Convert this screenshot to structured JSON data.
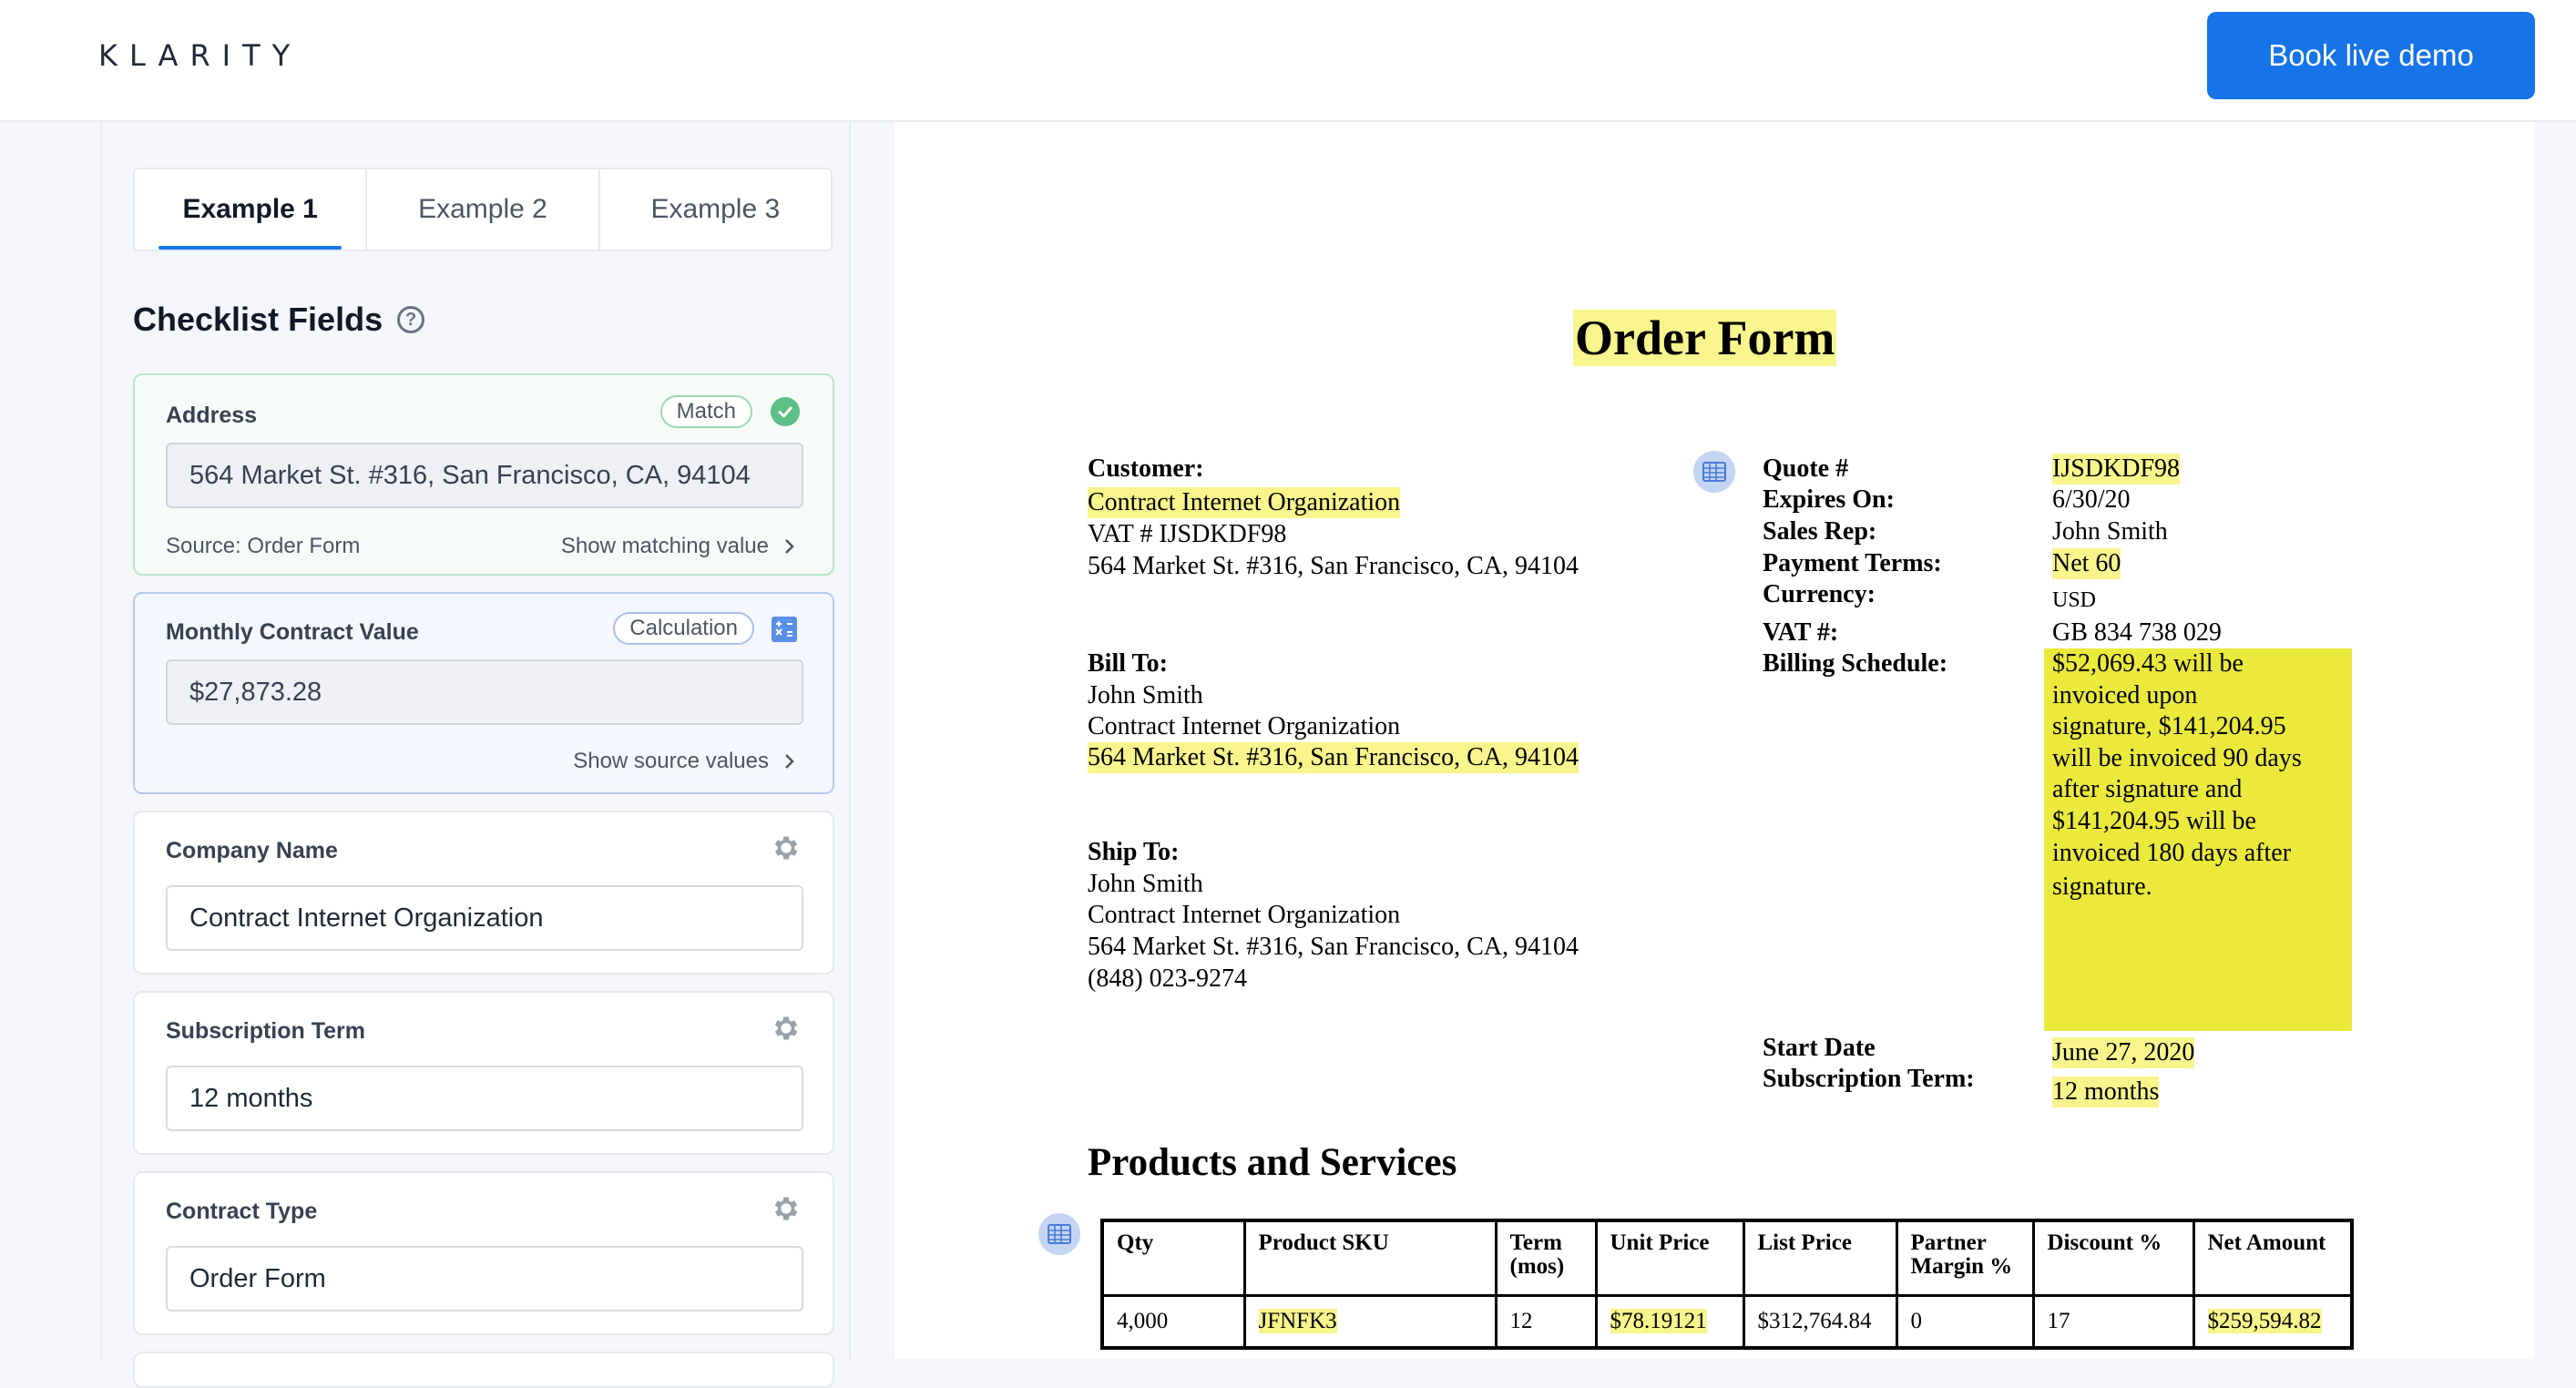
{
  "header": {
    "logo": "KLARITY",
    "demo_button": "Book live demo"
  },
  "tabs": [
    {
      "label": "Example 1",
      "active": true
    },
    {
      "label": "Example 2",
      "active": false
    },
    {
      "label": "Example 3",
      "active": false
    }
  ],
  "checklist": {
    "title": "Checklist Fields",
    "address": {
      "label": "Address",
      "badge": "Match",
      "value": "564 Market St. #316, San Francisco, CA, 94104",
      "source": "Source: Order Form",
      "link": "Show matching value"
    },
    "monthly": {
      "label": "Monthly Contract Value",
      "badge": "Calculation",
      "value": "$27,873.28",
      "link": "Show source values"
    },
    "company": {
      "label": "Company Name",
      "value": "Contract Internet Organization"
    },
    "subscription": {
      "label": "Subscription Term",
      "value": "12 months"
    },
    "contract_type": {
      "label": "Contract Type",
      "value": "Order Form"
    }
  },
  "document": {
    "title": "Order Form",
    "customer": {
      "label": "Customer:",
      "name": "Contract Internet Organization",
      "vat": "VAT # IJSDKDF98",
      "address": "564 Market St. #316, San Francisco, CA, 94104"
    },
    "bill_to": {
      "label": "Bill To:",
      "person": "John Smith",
      "org": "Contract Internet Organization",
      "address": "564 Market St. #316, San Francisco, CA, 94104"
    },
    "ship_to": {
      "label": "Ship To:",
      "person": "John Smith",
      "org": "Contract Internet Organization",
      "address": "564 Market St. #316, San Francisco, CA, 94104",
      "phone": "(848) 023-9274"
    },
    "quote": {
      "quote_label": "Quote #",
      "quote_value": "IJSDKDF98",
      "expires_label": "Expires On:",
      "expires_value": "6/30/20",
      "rep_label": "Sales Rep:",
      "rep_value": "John Smith",
      "terms_label": "Payment Terms:",
      "terms_value": "Net 60",
      "currency_label": "Currency:",
      "currency_value": "USD",
      "vat_label": "VAT #:",
      "vat_value": "GB 834 738 029",
      "billing_label": "Billing Schedule:",
      "billing_lines": [
        "$52,069.43 will be",
        "invoiced upon",
        "signature, $141,204.95",
        "will be invoiced 90 days",
        "after signature and",
        "$141,204.95 will be",
        "invoiced 180 days after",
        "signature."
      ],
      "start_label": "Start Date",
      "start_value": "June 27, 2020",
      "term_label": "Subscription Term:",
      "term_value": "12 months"
    },
    "products": {
      "title": "Products and Services",
      "headers": [
        "Qty",
        "Product SKU",
        "Term (mos)",
        "Unit Price",
        "List Price",
        "Partner Margin %",
        "Discount %",
        "Net Amount"
      ],
      "rows": [
        [
          "4,000",
          "JFNFK3",
          "12",
          "$78.19121",
          "$312,764.84",
          "0",
          "17",
          "$259,594.82"
        ]
      ]
    }
  },
  "colors": {
    "accent": "#1673e8",
    "highlight": "#f7f58c",
    "highlight_strong": "#ebe93c",
    "match": "#5cbf85"
  }
}
